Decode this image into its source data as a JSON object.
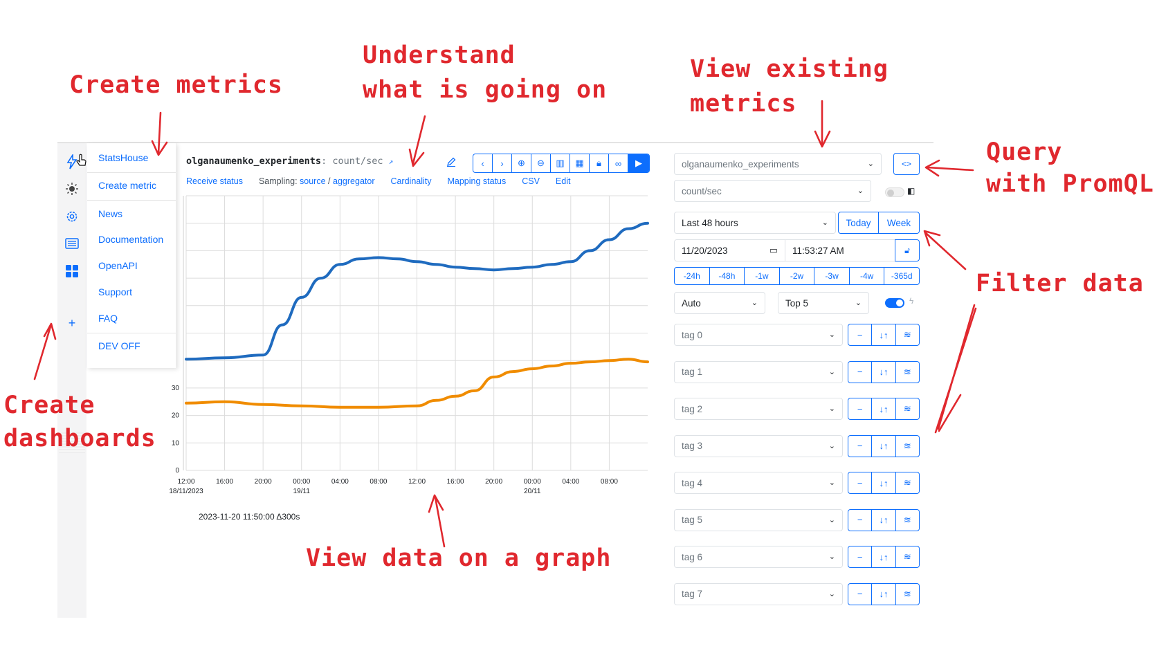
{
  "annotations": {
    "create_metrics": "Create metrics",
    "understand_line1": "Understand",
    "understand_line2": "what is going on",
    "view_existing_line1": "View existing",
    "view_existing_line2": "metrics",
    "query_line1": "Query",
    "query_line2": "with PromQL",
    "filter_data": "Filter data",
    "create_dash_line1": "Create",
    "create_dash_line2": "dashboards",
    "view_graph": "View data on a graph",
    "color": "#e0282e"
  },
  "rail": {
    "icons": [
      "lightning-icon",
      "sun-icon",
      "gear-icon",
      "list-icon",
      "dashboard-grid-icon"
    ],
    "add_label": "+"
  },
  "menu": {
    "items": [
      "StatsHouse",
      "Create metric",
      "News",
      "Documentation",
      "OpenAPI",
      "Support",
      "FAQ",
      "DEV OFF"
    ]
  },
  "graph": {
    "metric_name": "olganaumenko_experiments",
    "metric_what": ": count/sec",
    "links": {
      "receive_status": "Receive status",
      "sampling_prefix": "Sampling:",
      "sampling_source": "source",
      "sampling_sep": "/",
      "sampling_aggregator": "aggregator",
      "cardinality": "Cardinality",
      "mapping_status": "Mapping status",
      "csv": "CSV",
      "edit": "Edit"
    },
    "toolbar_icons": [
      "chevron-left-icon",
      "chevron-right-icon",
      "zoom-in-icon",
      "zoom-out-icon",
      "columns-icon",
      "table-icon",
      "lock-icon",
      "link-icon",
      "play-icon"
    ],
    "footer": "2023-11-20 11:50:00  Δ300s"
  },
  "chart_data": {
    "type": "line",
    "x": [
      "12:00",
      "16:00",
      "20:00",
      "00:00",
      "04:00",
      "08:00",
      "12:00",
      "16:00",
      "20:00",
      "00:00",
      "04:00",
      "08:00"
    ],
    "x_sublabels": [
      "18/11/2023",
      "",
      "",
      "19/11",
      "",
      "",
      "",
      "",
      "",
      "20/11",
      "",
      ""
    ],
    "ylim": [
      0,
      100
    ],
    "y_ticks": [
      0,
      10,
      20,
      30
    ],
    "grid": true,
    "series": [
      {
        "color": "#1f6bbf",
        "points": [
          [
            0,
            40.5
          ],
          [
            1,
            41
          ],
          [
            2,
            42
          ],
          [
            2.5,
            53
          ],
          [
            3,
            63
          ],
          [
            3.5,
            70
          ],
          [
            4,
            75
          ],
          [
            4.5,
            77
          ],
          [
            5,
            77.5
          ],
          [
            5.5,
            77
          ],
          [
            6,
            76
          ],
          [
            6.5,
            75
          ],
          [
            7,
            74
          ],
          [
            7.5,
            73.5
          ],
          [
            8,
            73
          ],
          [
            8.5,
            73.5
          ],
          [
            9,
            74
          ],
          [
            9.5,
            75
          ],
          [
            10,
            76
          ],
          [
            10.5,
            80
          ],
          [
            11,
            84
          ],
          [
            11.5,
            88
          ],
          [
            12,
            90
          ]
        ]
      },
      {
        "color": "#f08c00",
        "points": [
          [
            0,
            24.5
          ],
          [
            1,
            25
          ],
          [
            2,
            24
          ],
          [
            3,
            23.5
          ],
          [
            4,
            23
          ],
          [
            5,
            23
          ],
          [
            6,
            23.5
          ],
          [
            6.5,
            25.5
          ],
          [
            7,
            27
          ],
          [
            7.5,
            29
          ],
          [
            8,
            34
          ],
          [
            8.5,
            36
          ],
          [
            9,
            37
          ],
          [
            9.5,
            38
          ],
          [
            10,
            39
          ],
          [
            10.5,
            39.5
          ],
          [
            11,
            40
          ],
          [
            11.5,
            40.5
          ],
          [
            12,
            39.5
          ]
        ]
      }
    ]
  },
  "panel": {
    "metric_select": "olganaumenko_experiments",
    "what_select": "count/sec",
    "period_select": "Last 48 hours",
    "today_label": "Today",
    "week_label": "Week",
    "date_value": "11/20/2023",
    "time_value": "11:53:27  AM",
    "shifts": [
      "-24h",
      "-48h",
      "-1w",
      "-2w",
      "-3w",
      "-4w",
      "-365d"
    ],
    "agg_select": "Auto",
    "top_select": "Top 5",
    "tags": [
      "tag 0",
      "tag 1",
      "tag 2",
      "tag 3",
      "tag 4",
      "tag 5",
      "tag 6",
      "tag 7"
    ],
    "tag_btns": [
      "−",
      "↓↑",
      "≋"
    ],
    "promql_label": "<>"
  }
}
